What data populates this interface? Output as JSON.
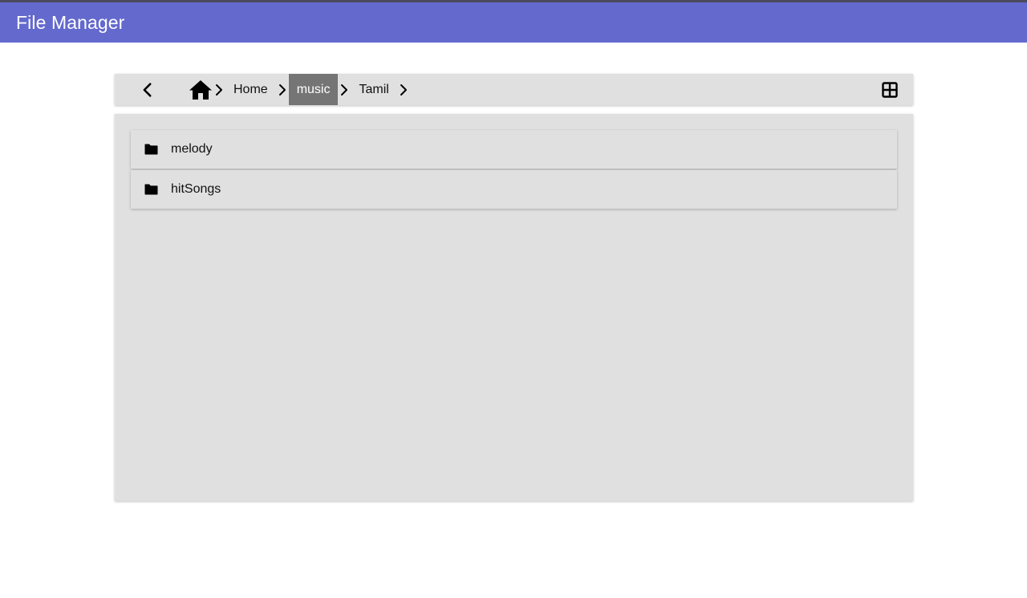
{
  "appbar": {
    "title": "File Manager",
    "color": "#6469cd"
  },
  "toolbar": {
    "back_icon": "chevron-left-icon",
    "home_icon": "home-icon",
    "view_icon": "grid-view-icon",
    "breadcrumbs": [
      {
        "label": "Home",
        "active": false
      },
      {
        "label": "music",
        "active": true
      },
      {
        "label": "Tamil",
        "active": false
      }
    ]
  },
  "files": {
    "items": [
      {
        "name": "melody",
        "icon": "folder-icon"
      },
      {
        "name": "hitSongs",
        "icon": "folder-icon"
      }
    ]
  }
}
